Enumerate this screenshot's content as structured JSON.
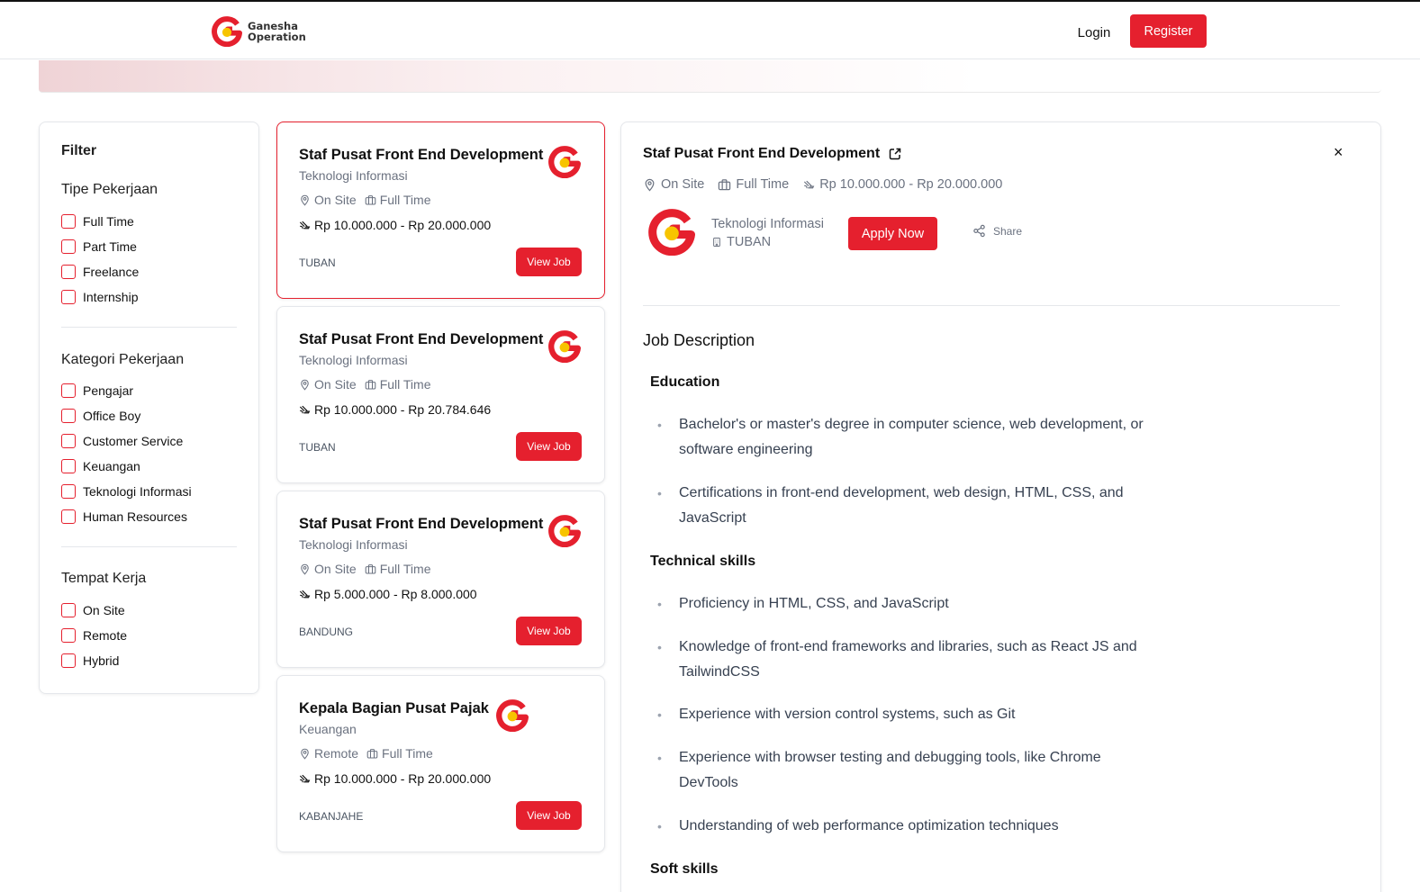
{
  "brand": {
    "name_line1": "Ganesha",
    "name_line2": "Operation",
    "accent": "#e5202e",
    "logo_yellow": "#f7c400"
  },
  "nav": {
    "login_label": "Login",
    "register_label": "Register"
  },
  "filter": {
    "title": "Filter",
    "groups": [
      {
        "title": "Tipe Pekerjaan",
        "options": [
          "Full Time",
          "Part Time",
          "Freelance",
          "Internship"
        ]
      },
      {
        "title": "Kategori Pekerjaan",
        "options": [
          "Pengajar",
          "Office Boy",
          "Customer Service",
          "Keuangan",
          "Teknologi Informasi",
          "Human Resources"
        ]
      },
      {
        "title": "Tempat Kerja",
        "options": [
          "On Site",
          "Remote",
          "Hybrid"
        ]
      }
    ]
  },
  "jobs": [
    {
      "title": "Staf Pusat Front End Development",
      "category": "Teknologi Informasi",
      "workplace": "On Site",
      "type": "Full Time",
      "salary": "Rp 10.000.000 - Rp 20.000.000",
      "city": "TUBAN",
      "button": "View Job"
    },
    {
      "title": "Staf Pusat Front End Development",
      "category": "Teknologi Informasi",
      "workplace": "On Site",
      "type": "Full Time",
      "salary": "Rp 10.000.000 - Rp 20.784.646",
      "city": "TUBAN",
      "button": "View Job"
    },
    {
      "title": "Staf Pusat Front End Development",
      "category": "Teknologi Informasi",
      "workplace": "On Site",
      "type": "Full Time",
      "salary": "Rp 5.000.000 - Rp 8.000.000",
      "city": "BANDUNG",
      "button": "View Job"
    },
    {
      "title": "Kepala Bagian Pusat Pajak",
      "category": "Keuangan",
      "workplace": "Remote",
      "type": "Full Time",
      "salary": "Rp 10.000.000 - Rp 20.000.000",
      "city": "KABANJAHE",
      "button": "View Job"
    }
  ],
  "detail": {
    "title": "Staf Pusat Front End Development",
    "close": "×",
    "workplace": "On Site",
    "type": "Full Time",
    "salary": "Rp 10.000.000 - Rp 20.000.000",
    "category": "Teknologi Informasi",
    "city": "TUBAN",
    "apply_label": "Apply Now",
    "share_label": "Share",
    "description_title": "Job Description",
    "sections": [
      {
        "title": "Education",
        "items": [
          "Bachelor's or master's degree in computer science, web development, or software engineering",
          "Certifications in front-end development, web design, HTML, CSS, and JavaScript"
        ]
      },
      {
        "title": "Technical skills",
        "items": [
          "Proficiency in HTML, CSS, and JavaScript",
          "Knowledge of front-end frameworks and libraries, such as React JS and TailwindCSS",
          "Experience with version control systems, such as Git",
          "Experience with browser testing and debugging tools, like Chrome DevTools",
          "Understanding of web performance optimization techniques"
        ]
      },
      {
        "title": "Soft skills",
        "items": []
      }
    ]
  }
}
